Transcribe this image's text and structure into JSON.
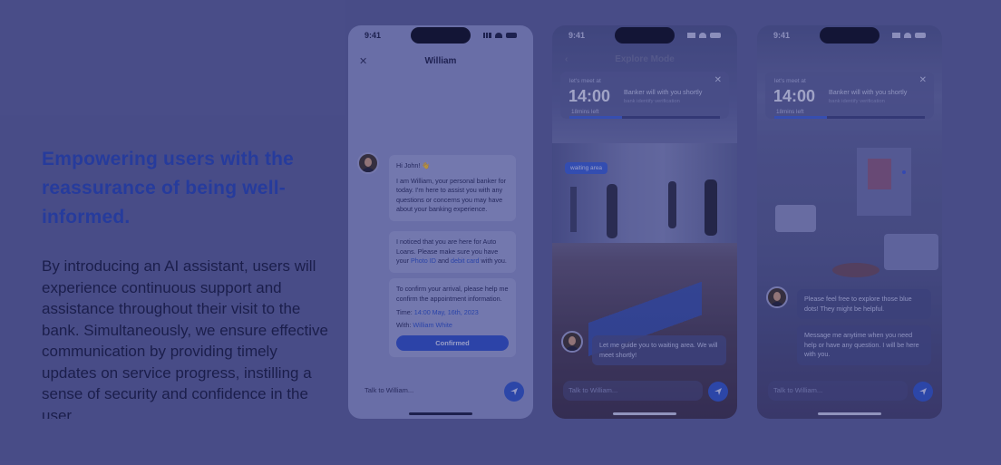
{
  "headline": "Empowering users with the reassurance of being well-informed.",
  "body": "By introducing an AI assistant, users will experience continuous support and assistance throughout their visit to the bank. Simultaneously, we ensure effective communication by providing timely updates on service progress, instilling a sense of security and confidence in the user.",
  "colors": {
    "accent": "#2544b6",
    "button": "#2e50c8",
    "background": "#5a5f96"
  },
  "phone1": {
    "time": "9:41",
    "title": "William",
    "close_icon": "close-icon",
    "msg1_greeting": "Hi John! 👋",
    "msg1_body": "I am William, your personal banker for today. I'm here to assist you with any questions or concerns you may have about your banking experience.",
    "msg2_pre": "I noticed that you are here for Auto Loans. Please make sure you have your",
    "msg2_link1": "Photo ID",
    "msg2_and": "and",
    "msg2_link2": "debit card",
    "msg2_post": "with you.",
    "msg3_body": "To confirm your arrival, please help me confirm the appointment information.",
    "time_label": "Time:",
    "time_value": "14:00  May, 16th, 2023",
    "with_label": "With:",
    "with_value": "William White",
    "confirm_label": "Confirmed",
    "input_placeholder": "Talk to William..."
  },
  "phone2": {
    "time": "9:41",
    "title": "Explore Mode",
    "meet_label": "let's meet at",
    "meet_time": "14:00",
    "mins_left": "18mins left",
    "banker_title": "Banker will with you shortly",
    "banker_sub": "bank identify verification",
    "waiting_pill": "waiting area",
    "message": "Let me guide you to waiting area. We will meet shortly!",
    "input_placeholder": "Talk to William..."
  },
  "phone3": {
    "time": "9:41",
    "meet_label": "let's meet at",
    "meet_time": "14:00",
    "mins_left": "18mins left",
    "banker_title": "Banker will with you shortly",
    "banker_sub": "bank identify verification",
    "message1": "Please feel free to explore those blue dots! They might be helpful.",
    "message2": "Message me anytime when you need help or have any question. I will be here with you.",
    "input_placeholder": "Talk to William..."
  }
}
